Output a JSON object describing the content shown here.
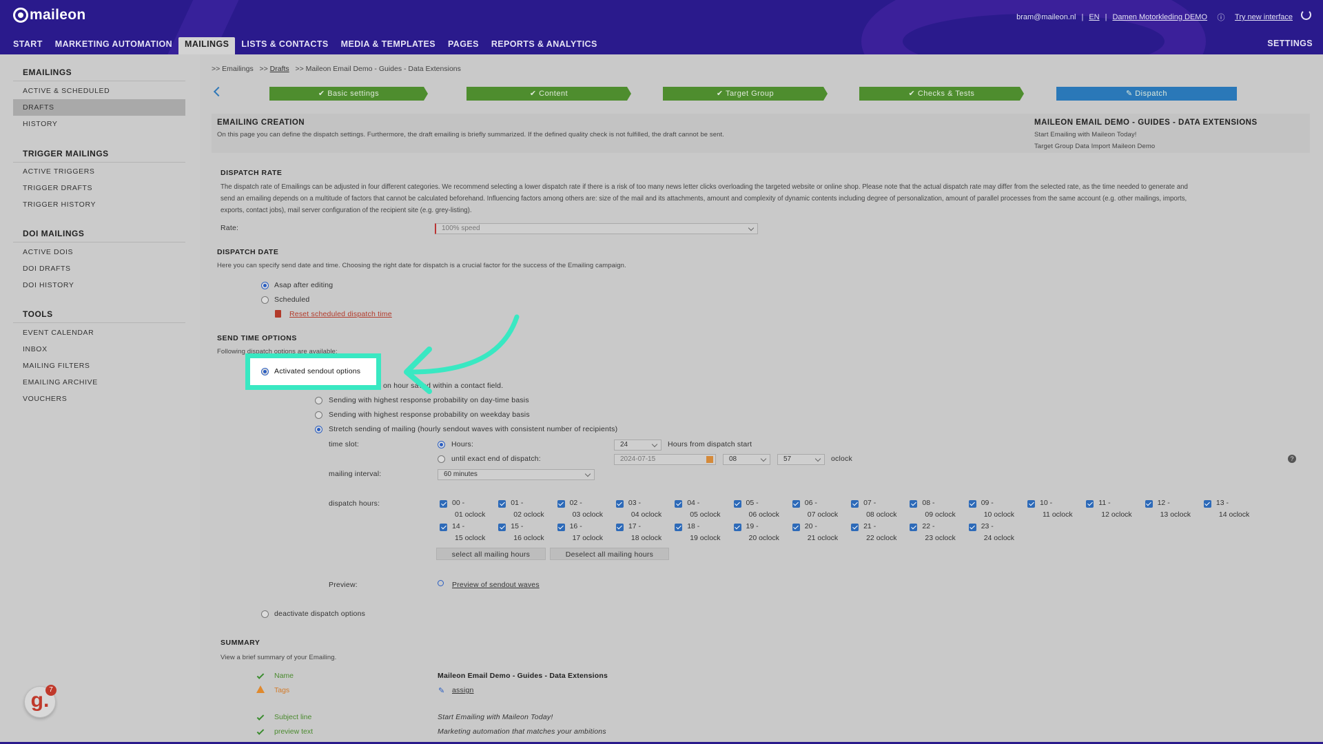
{
  "header": {
    "logo": "maileon",
    "user_email": "bram@maileon.nl",
    "sep1": "|",
    "lang": "EN",
    "sep2": "|",
    "account": "Damen Motorkleding DEMO",
    "try_new": "Try new interface",
    "nav": [
      "START",
      "MARKETING AUTOMATION",
      "MAILINGS",
      "LISTS & CONTACTS",
      "MEDIA & TEMPLATES",
      "PAGES",
      "REPORTS & ANALYTICS"
    ],
    "active_nav": "MAILINGS",
    "settings": "SETTINGS"
  },
  "sidebar": {
    "sections": [
      {
        "title": "EMAILINGS",
        "items": [
          "ACTIVE & SCHEDULED",
          "DRAFTS",
          "HISTORY"
        ]
      },
      {
        "title": "TRIGGER MAILINGS",
        "items": [
          "ACTIVE TRIGGERS",
          "TRIGGER DRAFTS",
          "TRIGGER HISTORY"
        ]
      },
      {
        "title": "DOI MAILINGS",
        "items": [
          "ACTIVE DOIS",
          "DOI DRAFTS",
          "DOI HISTORY"
        ]
      },
      {
        "title": "TOOLS",
        "items": [
          "EVENT CALENDAR",
          "INBOX",
          "MAILING FILTERS",
          "EMAILING ARCHIVE",
          "VOUCHERS"
        ]
      }
    ],
    "active_item": "DRAFTS"
  },
  "breadcrumb": {
    "p1": ">> Emailings",
    "p2": ">>",
    "drafts": "Drafts",
    "p3": ">> Maileon Email Demo - Guides - Data Extensions"
  },
  "steps": [
    "Basic settings",
    "Content",
    "Target Group",
    "Checks & Tests",
    "Dispatch"
  ],
  "creation": {
    "title": "EMAILING CREATION",
    "desc": "On this page you can define the dispatch settings. Furthermore, the draft emailing is briefly summarized. If the defined quality check is not fulfilled, the draft cannot be sent.",
    "mailing_title": "MAILEON EMAIL DEMO - GUIDES - DATA EXTENSIONS",
    "subject": "Start Emailing with Maileon Today!",
    "target": "Target Group Data Import Maileon Demo"
  },
  "dispatch_rate": {
    "title": "DISPATCH RATE",
    "line1": "The dispatch rate of Emailings can be adjusted in four different categories. We recommend selecting a lower dispatch rate if there is a risk of too many news letter clicks overloading the targeted website or online shop. Please note that the actual dispatch rate may differ from the selected rate, as the time needed to generate and",
    "line2": "send an emailing depends on a multitude of factors that cannot be calculated beforehand. Influencing factors among others are: size of the mail and its attachments, amount and complexity of dynamic contents including degree of personalization, amount of parallel processes from the same account (e.g. other mailings, imports,",
    "line3": "exports, contact jobs), mail server configuration of the recipient site (e.g. grey-listing).",
    "rate_label": "Rate:",
    "rate_value": "100% speed"
  },
  "dispatch_date": {
    "title": "DISPATCH DATE",
    "desc": "Here you can specify send date and time. Choosing the right date for dispatch is a crucial factor for the success of the Emailing campaign.",
    "opt_asap": "Asap after editing",
    "opt_scheduled": "Scheduled",
    "reset": "Reset scheduled dispatch time"
  },
  "send_time": {
    "title": "SEND TIME OPTIONS",
    "desc": "Following dispatch options are available:",
    "activated": "Activated sendout options",
    "partial": "on hour saved within a contact field.",
    "opt_daytime": "Sending with highest response probability on day-time basis",
    "opt_weekday": "Sending with highest response probability on weekday basis",
    "opt_stretch": "Stretch sending of mailing (hourly sendout waves with consistent number of recipients)",
    "time_slot": "time slot:",
    "hours_label": "Hours:",
    "hours_value": "24",
    "hours_suffix": "Hours from dispatch start",
    "until_label": "until exact end of dispatch:",
    "until_date": "2024-07-15",
    "until_hour": "08",
    "until_min": "57",
    "oclock": "oclock",
    "interval_label": "mailing interval:",
    "interval_value": "60 minutes",
    "dispatch_hours_label": "dispatch hours:",
    "hours_row1": [
      {
        "a": "00 -",
        "b": "01 oclock"
      },
      {
        "a": "01 -",
        "b": "02 oclock"
      },
      {
        "a": "02 -",
        "b": "03 oclock"
      },
      {
        "a": "03 -",
        "b": "04 oclock"
      },
      {
        "a": "04 -",
        "b": "05 oclock"
      },
      {
        "a": "05 -",
        "b": "06 oclock"
      },
      {
        "a": "06 -",
        "b": "07 oclock"
      },
      {
        "a": "07 -",
        "b": "08 oclock"
      },
      {
        "a": "08 -",
        "b": "09 oclock"
      },
      {
        "a": "09 -",
        "b": "10 oclock"
      },
      {
        "a": "10 -",
        "b": "11 oclock"
      },
      {
        "a": "11 -",
        "b": "12 oclock"
      },
      {
        "a": "12 -",
        "b": "13 oclock"
      },
      {
        "a": "13 -",
        "b": "14 oclock"
      }
    ],
    "hours_row2": [
      {
        "a": "14 -",
        "b": "15 oclock"
      },
      {
        "a": "15 -",
        "b": "16 oclock"
      },
      {
        "a": "16 -",
        "b": "17 oclock"
      },
      {
        "a": "17 -",
        "b": "18 oclock"
      },
      {
        "a": "18 -",
        "b": "19 oclock"
      },
      {
        "a": "19 -",
        "b": "20 oclock"
      },
      {
        "a": "20 -",
        "b": "21 oclock"
      },
      {
        "a": "21 -",
        "b": "22 oclock"
      },
      {
        "a": "22 -",
        "b": "23 oclock"
      },
      {
        "a": "23 -",
        "b": "24 oclock"
      }
    ],
    "select_all": "select all mailing hours",
    "deselect_all": "Deselect all mailing hours",
    "preview_label": "Preview:",
    "preview_link": "Preview of sendout waves",
    "deactivate": "deactivate dispatch options"
  },
  "summary": {
    "title": "SUMMARY",
    "desc": "View a brief summary of your Emailing.",
    "name_label": "Name",
    "name_value": "Maileon Email Demo - Guides - Data Extensions",
    "tags_label": "Tags",
    "tags_value": "assign",
    "subject_label": "Subject line",
    "subject_value": "Start Emailing with Maileon Today!",
    "preview_label": "preview text",
    "preview_value": "Marketing automation that matches your ambitions"
  },
  "widget": {
    "letter": "g.",
    "badge": "7"
  },
  "colors": {
    "header": "#2a1a8c",
    "step_done": "#4e8d2e",
    "step_current": "#2a78b8",
    "highlight": "#39e8c2"
  }
}
